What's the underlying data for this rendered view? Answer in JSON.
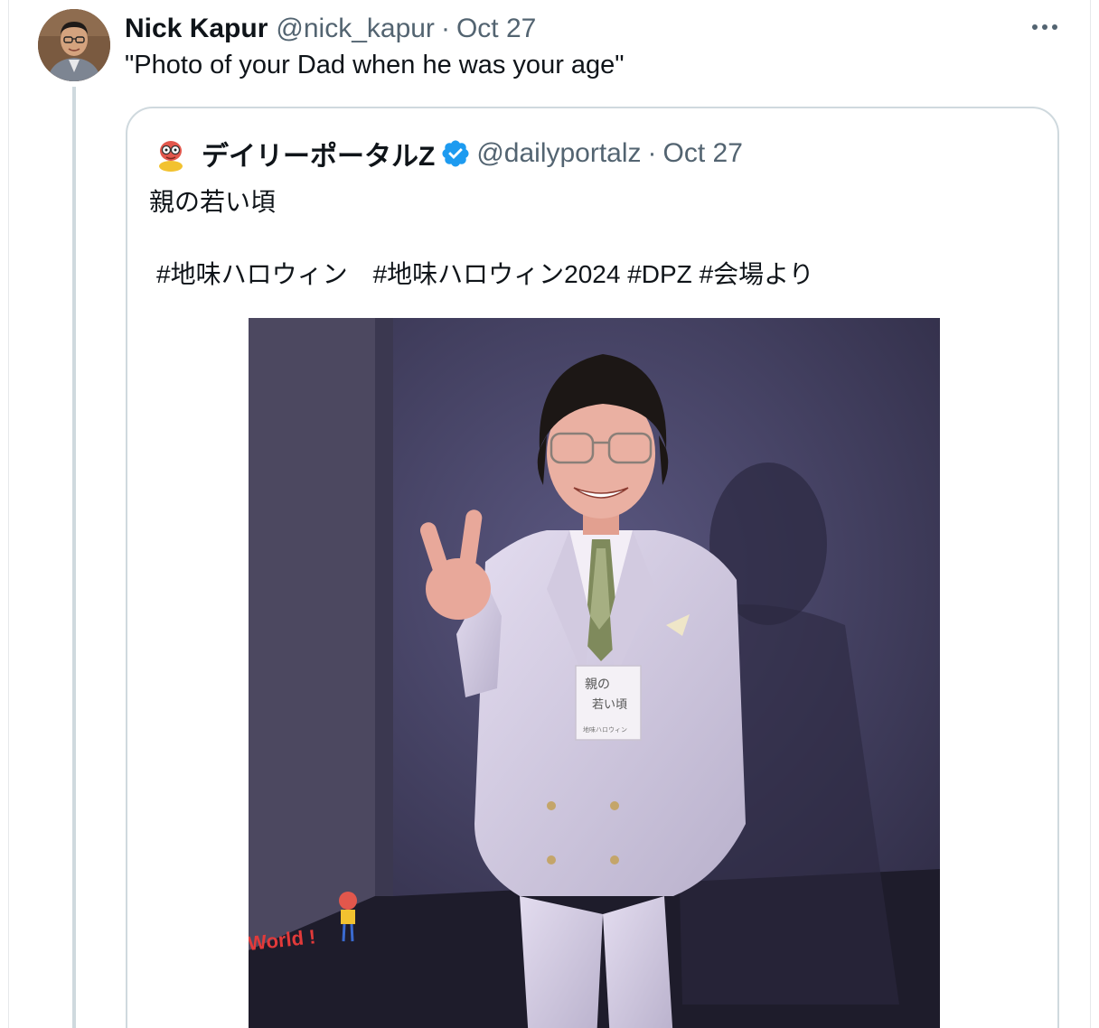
{
  "tweet": {
    "display_name": "Nick Kapur",
    "handle": "@nick_kapur",
    "separator": "·",
    "date": "Oct 27",
    "more_icon": "more-horizontal-icon",
    "text": "\"Photo of your Dad when he was your age\""
  },
  "quote": {
    "display_name": "デイリーポータルZ",
    "verified": true,
    "handle": "@dailyportalz",
    "separator": "·",
    "date": "Oct 27",
    "text": "親の若い頃",
    "hashtags": "#地味ハロウィン　#地味ハロウィン2024 #DPZ #会場より",
    "photo_badge": {
      "line1": "親の",
      "line2": "若い頃",
      "line3": "地味ハロウィン"
    },
    "photo_floor_text": "World !"
  },
  "colors": {
    "text_primary": "#0f1419",
    "text_secondary": "#536471",
    "border": "#cfd9de",
    "verified_blue": "#1d9bf0"
  }
}
